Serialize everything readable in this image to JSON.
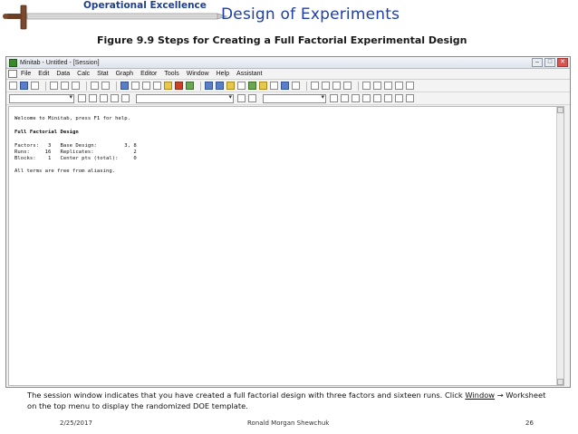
{
  "slide": {
    "brand_label": "Operational Excellence",
    "main_title": "Design of Experiments",
    "figure_title": "Figure 9.9  Steps for Creating a Full Factorial Experimental Design"
  },
  "window": {
    "title": "Minitab - Untitled - [Session]",
    "controls": {
      "minimize": "–",
      "maximize": "□",
      "close": "✕"
    },
    "menu": [
      "File",
      "Edit",
      "Data",
      "Calc",
      "Stat",
      "Graph",
      "Editor",
      "Tools",
      "Window",
      "Help",
      "Assistant"
    ]
  },
  "session": {
    "welcome": "Welcome to Minitab, press F1 for help.",
    "heading": "Full Factorial Design",
    "rows": [
      "Factors:   3   Base Design:         3, 8",
      "Runs:     16   Replicates:             2",
      "Blocks:    1   Center pts (total):     0"
    ],
    "alias_note": "All terms are free from aliasing."
  },
  "note": {
    "pre": "The session window indicates that you have created a full factorial design with three factors and sixteen runs.  Click ",
    "menu_word": "Window",
    "post_line1": " → Worksheet",
    "line2": "on the top menu to display the randomized DOE template."
  },
  "footer": {
    "date": "2/25/2017",
    "author": "Ronald Morgan Shewchuk",
    "page": "26"
  }
}
